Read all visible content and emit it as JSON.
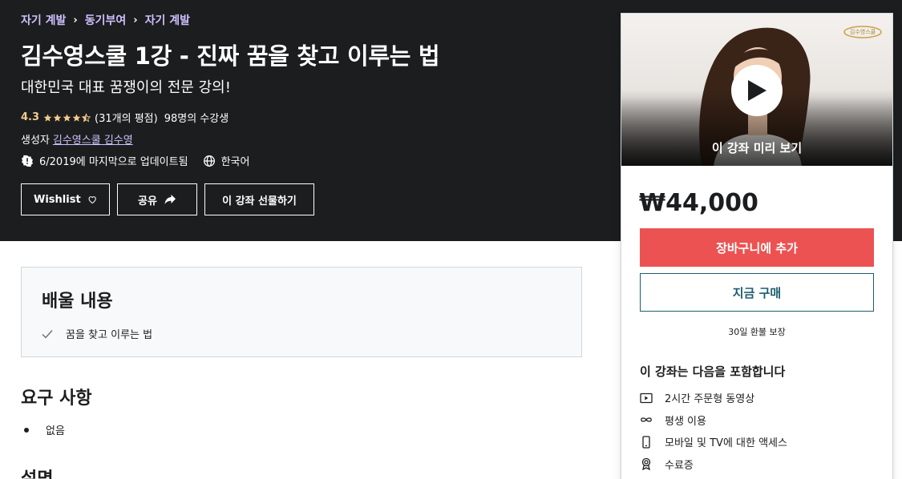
{
  "breadcrumb": {
    "items": [
      "자기 계발",
      "동기부여",
      "자기 계발"
    ],
    "separator": "›"
  },
  "course": {
    "title": "김수영스쿨 1강 - 진짜 꿈을 찾고 이루는 법",
    "subtitle": "대한민국 대표 꿈쟁이의 전문 강의!",
    "rating": "4.3",
    "rating_value": 4.3,
    "rating_count": "(31개의 평점)",
    "students": "98명의 수강생",
    "creator_label": "생성자",
    "creator_name": "김수영스쿨 김수영",
    "updated": "6/2019에 마지막으로 업데이트됨",
    "language": "한국어"
  },
  "actions": {
    "wishlist": "Wishlist",
    "share": "공유",
    "gift": "이 강좌 선물하기"
  },
  "learn": {
    "title": "배울 내용",
    "items": [
      "꿈을 찾고 이루는 법"
    ]
  },
  "requirements": {
    "title": "요구 사항",
    "items": [
      "없음"
    ]
  },
  "description": {
    "title": "설명"
  },
  "sidebar": {
    "preview_label": "이 강좌 미리 보기",
    "logo_text": "김수영스쿨",
    "price": "₩44,000",
    "add_to_cart": "장바구니에 추가",
    "buy_now": "지금 구매",
    "guarantee": "30일 환불 보장",
    "includes_title": "이 강좌는 다음을 포함합니다",
    "includes": [
      {
        "icon": "video-icon",
        "label": "2시간 주문형 동영상"
      },
      {
        "icon": "infinity-icon",
        "label": "평생 이용"
      },
      {
        "icon": "mobile-icon",
        "label": "모바일 및 TV에 대한 액세스"
      },
      {
        "icon": "certificate-icon",
        "label": "수료증"
      }
    ]
  },
  "colors": {
    "hero_bg": "#1c1d1f",
    "link_purple": "#cec0fc",
    "rating_gold": "#f3ca8c",
    "cart_red": "#ec5252",
    "buy_teal": "#1c5e6e"
  }
}
